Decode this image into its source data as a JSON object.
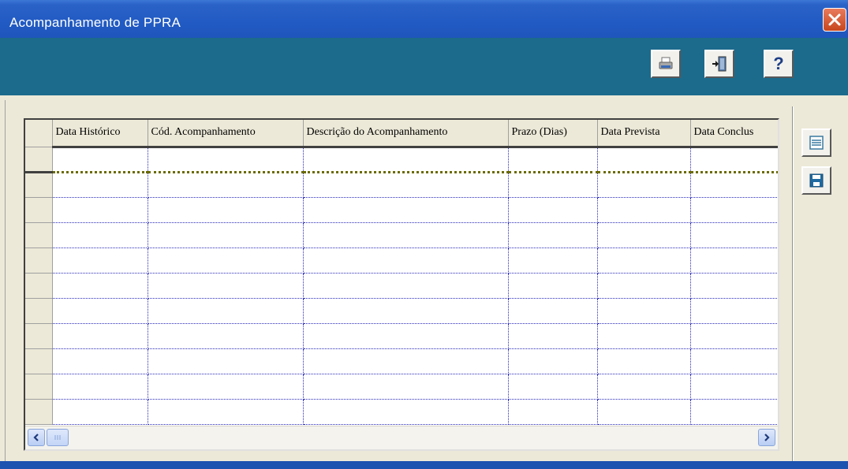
{
  "window": {
    "title": "Acompanhamento de PPRA"
  },
  "toolbar": {
    "buttons": [
      {
        "icon": "printer-icon"
      },
      {
        "icon": "exit-door-icon"
      },
      {
        "icon": "help-icon",
        "glyph": "?"
      }
    ]
  },
  "side_buttons": [
    {
      "icon": "list-icon"
    },
    {
      "icon": "save-icon"
    }
  ],
  "grid": {
    "columns": [
      "Data Histórico",
      "Cód. Acompanhamento",
      "Descrição do Acompanhamento",
      "Prazo (Dias)",
      "Data Prevista",
      "Data Conclus"
    ],
    "row_count": 11
  },
  "colors": {
    "titlebar": "#215ac3",
    "toolbar": "#1c6a8c",
    "close_button": "#d8572e",
    "grid_dotted_lines": "#2a2ab8"
  }
}
